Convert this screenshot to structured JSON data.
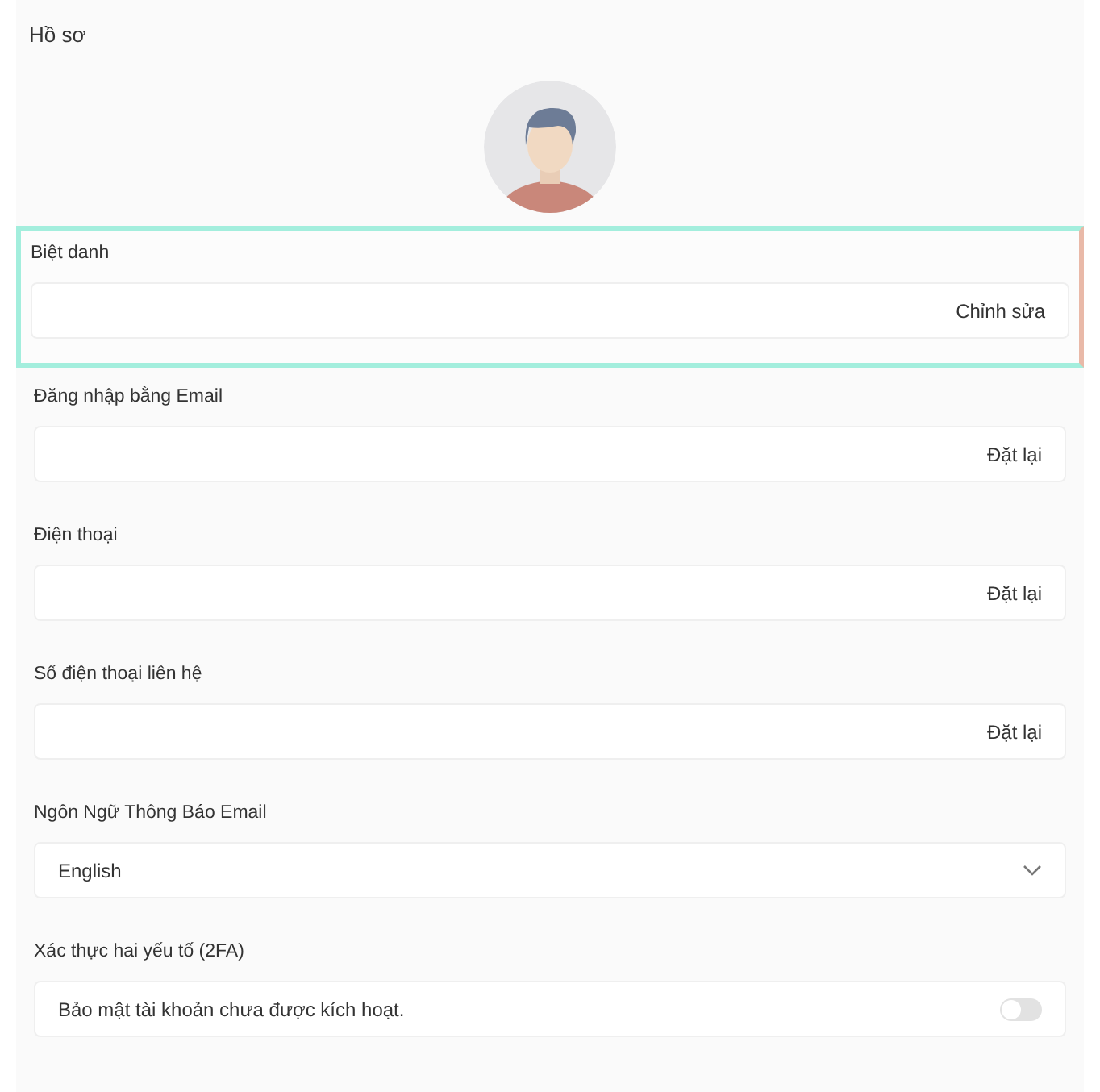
{
  "title": "Hồ sơ",
  "fields": [
    {
      "kind": "action",
      "label": "Biệt danh",
      "action": "Chỉnh sửa",
      "highlighted": true
    },
    {
      "kind": "action",
      "label": "Đăng nhập bằng Email",
      "action": "Đặt lại",
      "highlighted": false
    },
    {
      "kind": "action",
      "label": "Điện thoại",
      "action": "Đặt lại",
      "highlighted": false
    },
    {
      "kind": "action",
      "label": "Số điện thoại liên hệ",
      "action": "Đặt lại",
      "highlighted": false
    },
    {
      "kind": "select",
      "label": "Ngôn Ngữ Thông Báo Email",
      "value": "English",
      "highlighted": false
    },
    {
      "kind": "toggle",
      "label": "Xác thực hai yếu tố (2FA)",
      "text": "Bảo mật tài khoản chưa được kích hoạt.",
      "on": false,
      "highlighted": false
    }
  ]
}
